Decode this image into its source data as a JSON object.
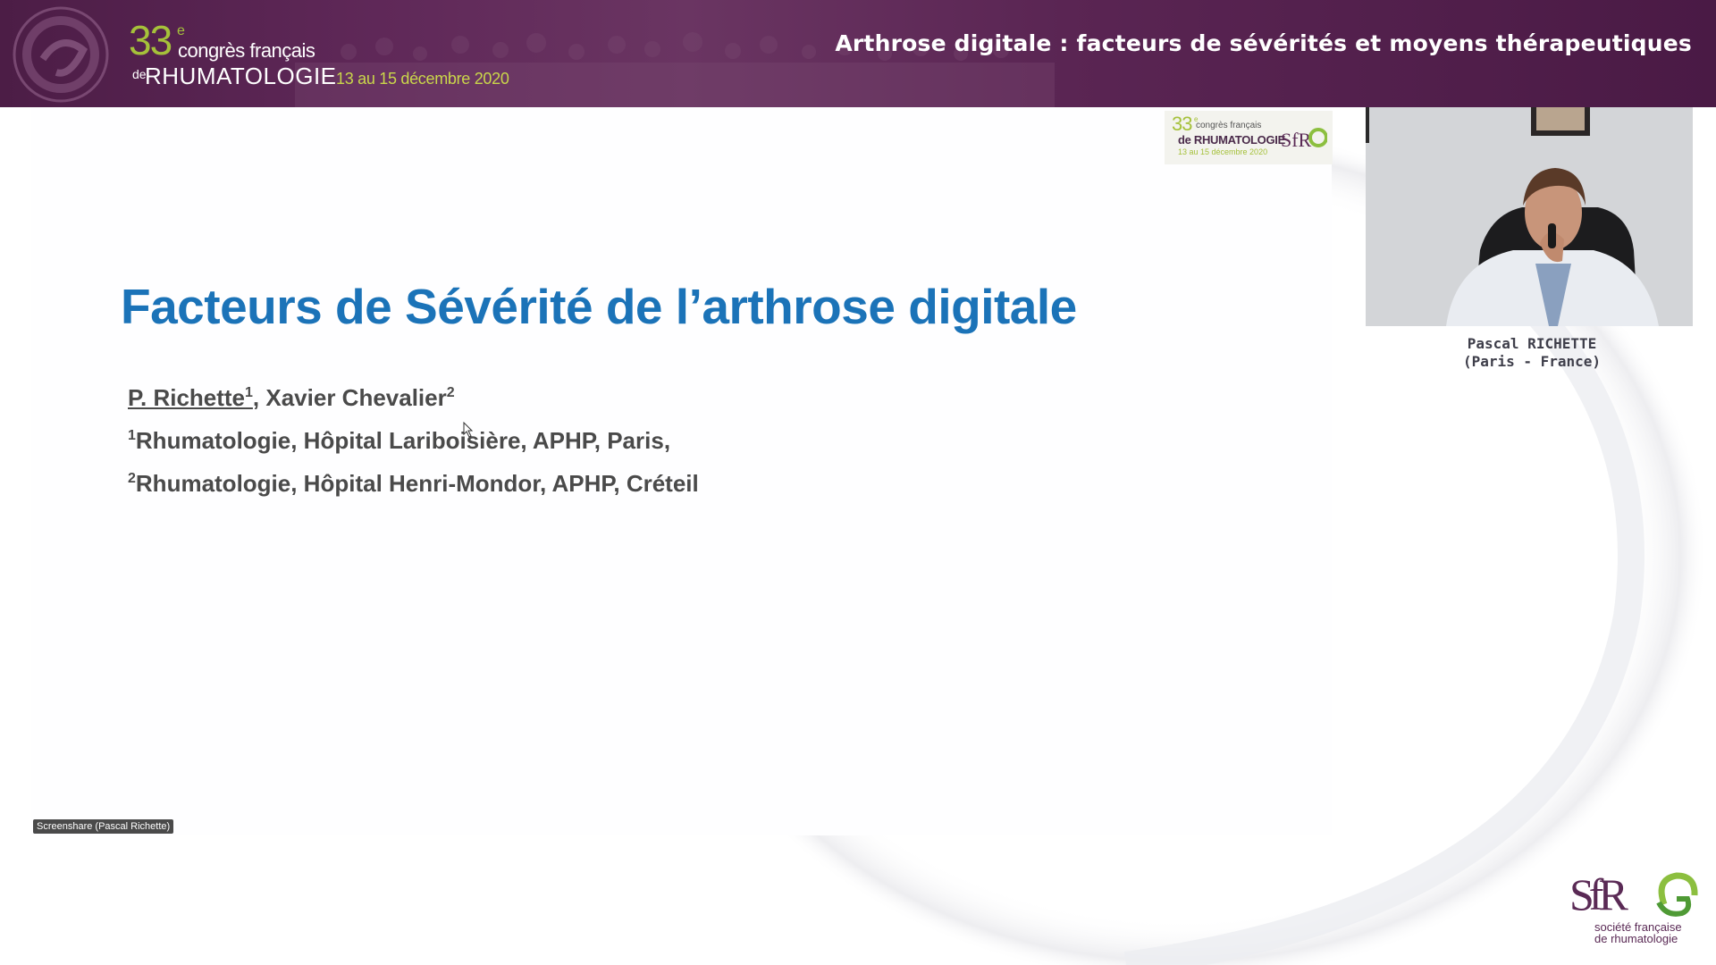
{
  "banner": {
    "congress_number": "33",
    "congress_superscript": "e",
    "congress_text": "congrès français",
    "congress_de": "de",
    "congress_name": "RHUMATOLOGIE",
    "congress_dates": "13 au 15 décembre 2020",
    "talk_title": "Arthrose digitale : facteurs de sévérités et moyens thérapeutiques"
  },
  "slide": {
    "logo": {
      "number": "33",
      "superscript": "e",
      "text": "congrès français",
      "name": "de RHUMATOLOGIE",
      "dates": "13 au 15 décembre 2020"
    },
    "title": "Facteurs de Sévérité de l’arthrose digitale",
    "authors": {
      "author1": "P. Richette",
      "author1_sup": "1",
      "author1_comma": ",",
      "author2": " Xavier Chevalier",
      "author2_sup": "2"
    },
    "affiliations": [
      {
        "sup": "1",
        "text": "Rhumatologie, Hôpital Lariboisière, APHP, Paris,"
      },
      {
        "sup": "2",
        "text": "Rhumatologie, Hôpital Henri-Mondor, APHP, Créteil"
      }
    ],
    "screenshare_label": "Screenshare (Pascal Richette)"
  },
  "speaker": {
    "name": "Pascal RICHETTE",
    "location": "(Paris - France)"
  },
  "sfr_logo": {
    "caption_line1": "société française",
    "caption_line2": "de rhumatologie"
  },
  "colors": {
    "banner_purple": "#5a2553",
    "accent_green": "#a5c13a",
    "title_blue": "#1b73b8",
    "text_gray": "#4a4a4a"
  },
  "icons": [
    "congress-logo-icon",
    "sfr-logo-icon",
    "mouse-cursor-icon"
  ]
}
